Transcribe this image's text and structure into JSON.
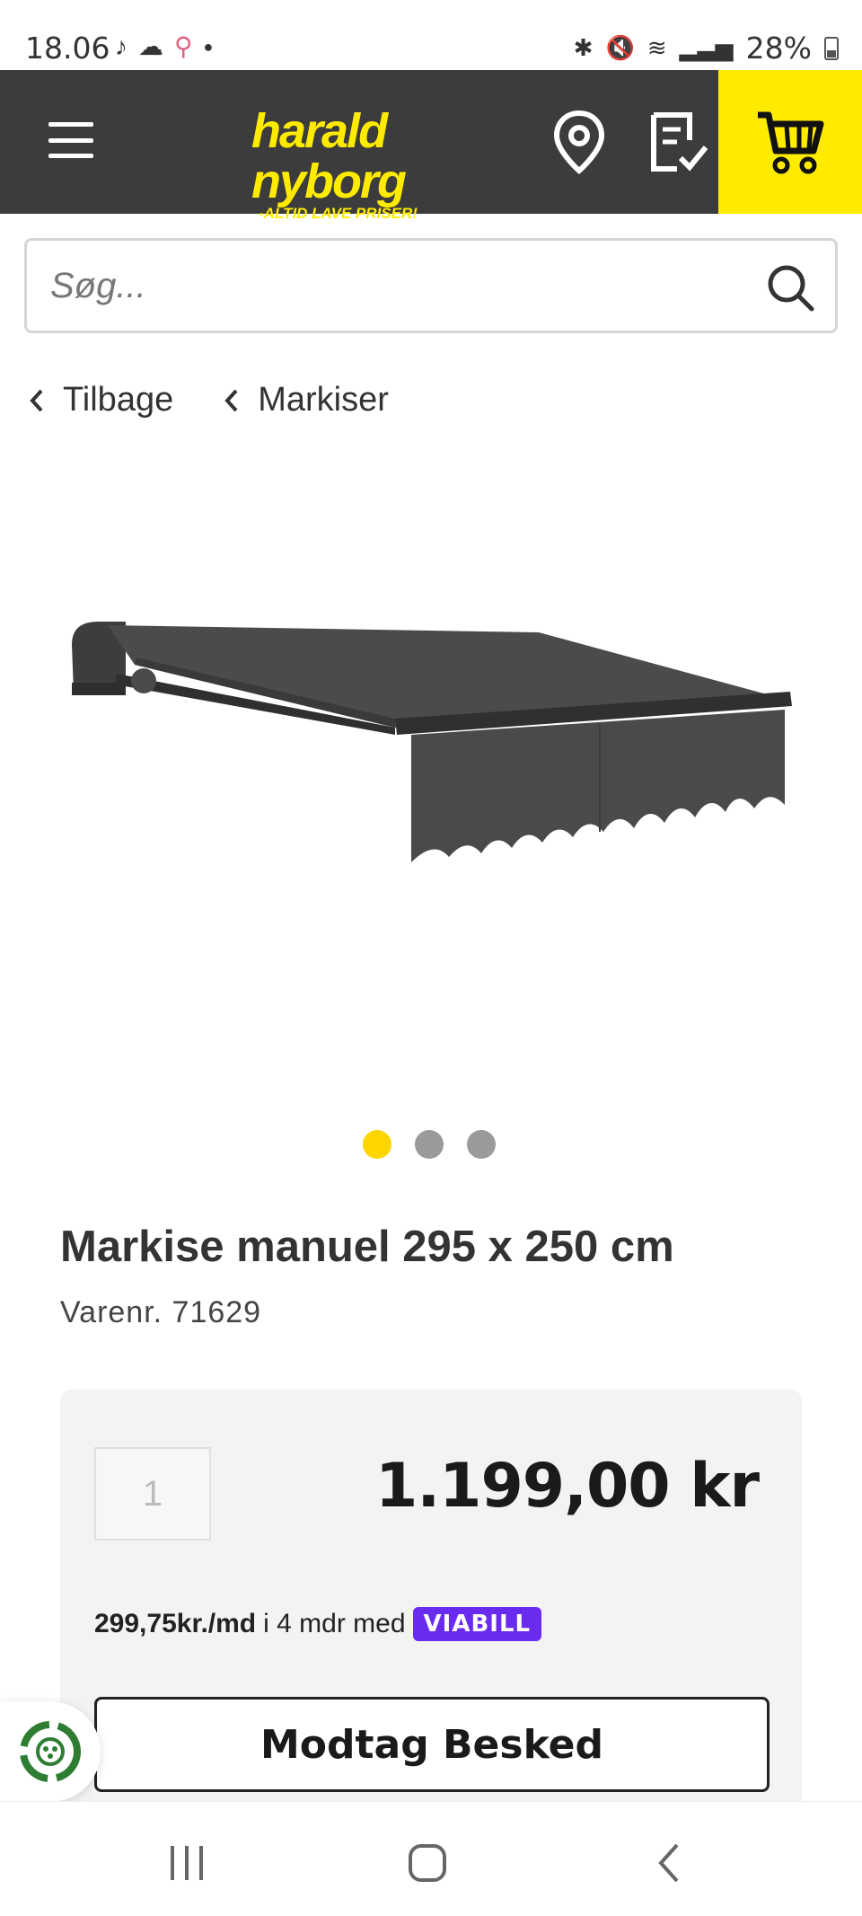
{
  "status_bar": {
    "time": "18.06",
    "battery": "28%"
  },
  "header": {
    "logo_main": "harald nyborg",
    "logo_tagline": "-ALTID LAVE PRISER!",
    "brand_yellow": "#ffeb00",
    "header_bg": "#3c3c3c"
  },
  "search": {
    "placeholder": "Søg..."
  },
  "breadcrumbs": [
    {
      "label": "Tilbage"
    },
    {
      "label": "Markiser"
    }
  ],
  "carousel": {
    "count": 3,
    "active_index": 0
  },
  "product": {
    "title": "Markise manuel 295 x 250 cm",
    "sku": "Varenr. 71629",
    "quantity": "1",
    "price": "1.199,00 kr",
    "installment_amount": "299,75kr./md",
    "installment_text": "i 4 mdr med",
    "installment_provider": "VIABILL",
    "notify_button": "Modtag Besked"
  },
  "icons": {
    "menu": "hamburger-icon",
    "location": "location-pin-icon",
    "list": "checklist-icon",
    "cart": "cart-icon",
    "search": "search-icon",
    "eco": "recycle-badge-icon"
  }
}
